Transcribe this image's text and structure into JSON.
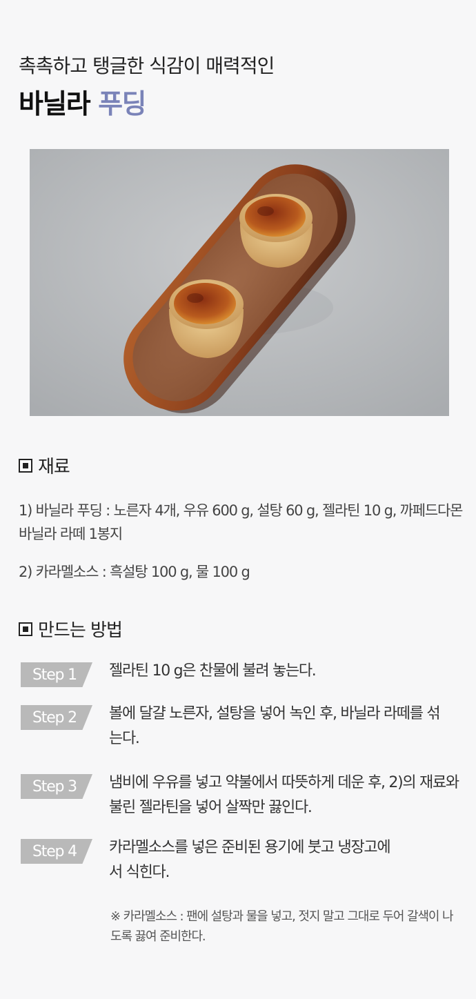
{
  "header": {
    "subtitle": "촉촉하고 탱글한 식감이 매력적인",
    "title_main": "바닐라",
    "title_accent": "푸딩"
  },
  "colors": {
    "accent": "#7a83b8",
    "badge": "#b9b9b9",
    "background": "#f7f7f8"
  },
  "ingredients": {
    "heading": "재료",
    "items": [
      "1) 바닐라 푸딩 : 노른자 4개, 우유 600 g, 설탕 60 g, 젤라틴 10 g, 까페드다몬 바닐라 라떼 1봉지",
      "2) 카라멜소스 : 흑설탕 100 g, 물 100 g"
    ]
  },
  "method": {
    "heading": "만드는 방법",
    "steps": [
      {
        "label": "Step 1",
        "text": "젤라틴 10 g은 찬물에 불려 놓는다."
      },
      {
        "label": "Step 2",
        "text": "볼에 달걀 노른자, 설탕을 넣어 녹인 후, 바닐라 라떼를 섞는다."
      },
      {
        "label": "Step 3",
        "text": "냄비에 우유를 넣고 약불에서 따뜻하게 데운 후, 2)의 재료와 불린 젤라틴을 넣어 살짝만 끓인다."
      },
      {
        "label": "Step 4",
        "text": "카라멜소스를 넣은 준비된 용기에 붓고 냉장고에서 식힌다."
      }
    ],
    "note": "※ 카라멜소스 : 팬에 설탕과 물을 넣고, 젓지 말고 그대로 두어 갈색이 나도록 끓여 준비한다."
  }
}
